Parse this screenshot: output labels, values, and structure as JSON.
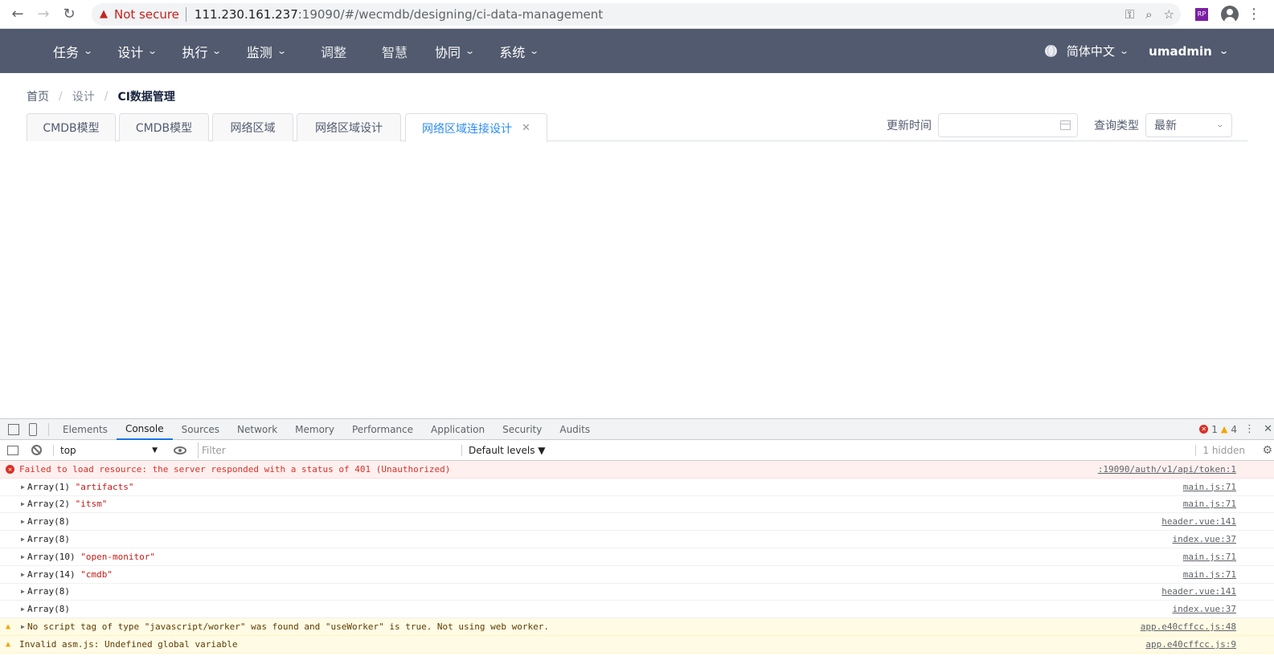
{
  "browser": {
    "security_label": "Not secure",
    "url_host": "111.230.161.237",
    "url_rest": ":19090/#/wecmdb/designing/ci-data-management",
    "extension_label": "RP"
  },
  "header": {
    "menu": [
      {
        "label": "任务",
        "dropdown": true
      },
      {
        "label": "设计",
        "dropdown": true
      },
      {
        "label": "执行",
        "dropdown": true
      },
      {
        "label": "监测",
        "dropdown": true
      },
      {
        "label": "调整",
        "dropdown": false
      },
      {
        "label": "智慧",
        "dropdown": false
      },
      {
        "label": "协同",
        "dropdown": true
      },
      {
        "label": "系统",
        "dropdown": true
      }
    ],
    "language": "简体中文",
    "user": "umadmin"
  },
  "breadcrumb": {
    "home": "首页",
    "section": "设计",
    "current": "CI数据管理"
  },
  "tabs": [
    {
      "label": "CMDB模型",
      "active": false
    },
    {
      "label": "CMDB模型",
      "active": false
    },
    {
      "label": "网络区域",
      "active": false
    },
    {
      "label": "网络区域设计",
      "active": false
    },
    {
      "label": "网络区域连接设计",
      "active": true
    }
  ],
  "filters": {
    "update_time_label": "更新时间",
    "update_time_value": "",
    "query_type_label": "查询类型",
    "query_type_value": "最新"
  },
  "devtools": {
    "tabs": [
      "Elements",
      "Console",
      "Sources",
      "Network",
      "Memory",
      "Performance",
      "Application",
      "Security",
      "Audits"
    ],
    "active_tab": "Console",
    "error_count": "1",
    "warning_count": "4",
    "context": "top",
    "filter_placeholder": "Filter",
    "levels": "Default levels ▼",
    "hidden": "1 hidden",
    "messages": [
      {
        "type": "error",
        "text": "Failed to load resource: the server responded with a status of 401 (Unauthorized)",
        "str": "",
        "source": ":19090/auth/v1/api/token:1"
      },
      {
        "type": "log",
        "text": "Array(1) ",
        "str": "\"artifacts\"",
        "source": "main.js:71"
      },
      {
        "type": "log",
        "text": "Array(2) ",
        "str": "\"itsm\"",
        "source": "main.js:71"
      },
      {
        "type": "log",
        "text": "Array(8)",
        "str": "",
        "source": "header.vue:141"
      },
      {
        "type": "log",
        "text": "Array(8)",
        "str": "",
        "source": "index.vue:37"
      },
      {
        "type": "log",
        "text": "Array(10) ",
        "str": "\"open-monitor\"",
        "source": "main.js:71"
      },
      {
        "type": "log",
        "text": "Array(14) ",
        "str": "\"cmdb\"",
        "source": "main.js:71"
      },
      {
        "type": "log",
        "text": "Array(8)",
        "str": "",
        "source": "header.vue:141"
      },
      {
        "type": "log",
        "text": "Array(8)",
        "str": "",
        "source": "index.vue:37"
      },
      {
        "type": "warning",
        "text": "No script tag of type \"javascript/worker\" was found and \"useWorker\" is true. Not using web worker.",
        "str": "",
        "source": "app.e40cffcc.js:48"
      },
      {
        "type": "warning",
        "text": "Invalid asm.js: Undefined global variable",
        "str": "",
        "source": "app.e40cffcc.js:9"
      }
    ]
  },
  "colors": {
    "header_bg": "#515a6e",
    "active_tab": "#2d8cf0",
    "error": "#d93025",
    "warning": "#f2a600"
  }
}
